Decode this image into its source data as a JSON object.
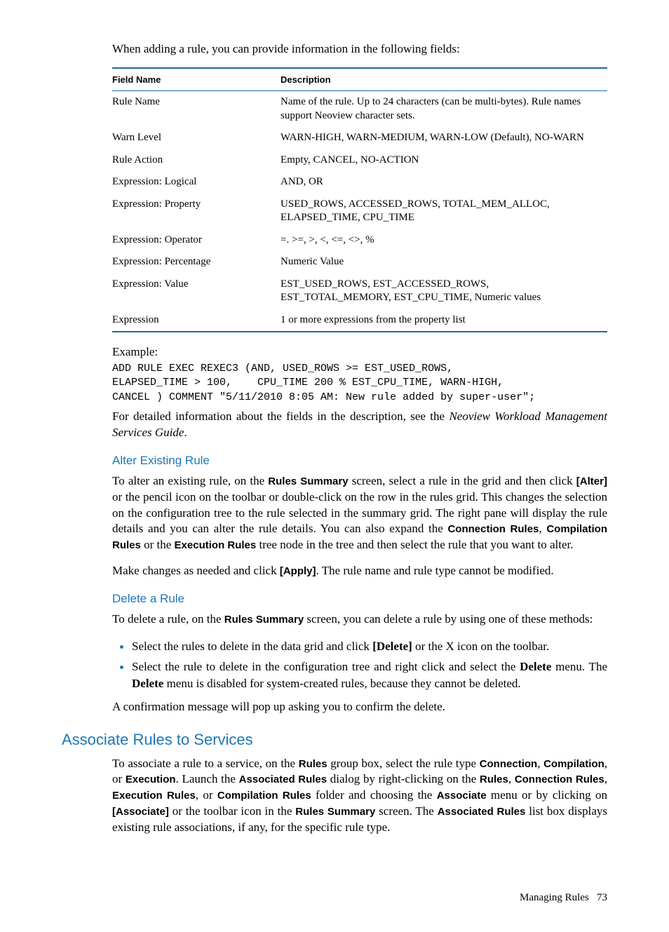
{
  "intro": "When adding a rule, you can provide information in the following fields:",
  "table": {
    "headers": {
      "field": "Field Name",
      "desc": "Description"
    },
    "rows": [
      {
        "field": "Rule Name",
        "desc": "Name of the rule. Up to 24 characters (can be multi-bytes). Rule names support Neoview character sets."
      },
      {
        "field": "Warn Level",
        "desc": "WARN-HIGH, WARN-MEDIUM, WARN-LOW (Default), NO-WARN"
      },
      {
        "field": "Rule Action",
        "desc": "Empty, CANCEL, NO-ACTION"
      },
      {
        "field": "Expression: Logical",
        "desc": "AND, OR"
      },
      {
        "field": "Expression: Property",
        "desc": "USED_ROWS, ACCESSED_ROWS, TOTAL_MEM_ALLOC, ELAPSED_TIME, CPU_TIME"
      },
      {
        "field": "Expression: Operator",
        "desc": "=. >=, >, <, <=, <>, %"
      },
      {
        "field": "Expression: Percentage",
        "desc": "Numeric Value"
      },
      {
        "field": "Expression: Value",
        "desc": "EST_USED_ROWS, EST_ACCESSED_ROWS, EST_TOTAL_MEMORY, EST_CPU_TIME, Numeric values"
      },
      {
        "field": "Expression",
        "desc": "1 or more expressions from the property list"
      }
    ]
  },
  "example_label": "Example:",
  "code": "ADD RULE EXEC REXEC3 (AND, USED_ROWS >= EST_USED_ROWS,\nELAPSED_TIME > 100,    CPU_TIME 200 % EST_CPU_TIME, WARN-HIGH,\nCANCEL ) COMMENT \"5/11/2010 8:05 AM: New rule added by super-user\";",
  "detail_a": "For detailed information about the fields in the description, see the ",
  "detail_b_italic": "Neoview Workload Management Services Guide",
  "detail_c": ".",
  "alter": {
    "heading": "Alter Existing Rule",
    "p1_parts": [
      "To alter an existing rule, on the ",
      "Rules Summary",
      " screen, select a rule in the grid and then click ",
      "[Alter]",
      " or the pencil icon on the toolbar or double-click on the row in the rules grid. This changes the selection on the configuration tree to the rule selected in the summary grid. The right pane will display the rule details and you can alter the rule details. You can also expand the ",
      "Connection Rules",
      ", ",
      "Compilation Rules",
      " or the ",
      "Execution Rules",
      " tree node in the tree and then select the rule that you want to alter."
    ],
    "p2_parts": [
      "Make changes as needed and click ",
      "[Apply]",
      ". The rule name and rule type cannot be modified."
    ]
  },
  "delete": {
    "heading": "Delete a Rule",
    "p1_parts": [
      "To delete a rule, on the ",
      "Rules Summary",
      " screen, you can delete a rule by using one of these methods:"
    ],
    "bullets": [
      [
        "Select the rules to delete in the data grid and click ",
        "[Delete]",
        " or the X icon on the toolbar."
      ],
      [
        "Select the rule to delete in the configuration tree and right click and select the ",
        "Delete",
        " menu. The ",
        "Delete",
        " menu is disabled for system-created rules, because they cannot be deleted."
      ]
    ],
    "p2": "A confirmation message will pop up asking you to confirm the delete."
  },
  "associate": {
    "heading": "Associate Rules to Services",
    "p_parts": [
      "To associate a rule to a service, on the ",
      "Rules",
      " group box, select the rule type ",
      "Connection",
      ", ",
      "Compilation",
      ", or ",
      "Execution",
      ". Launch the ",
      "Associated Rules",
      " dialog by right-clicking on the ",
      "Rules",
      ", ",
      "Connection Rules",
      ", ",
      "Execution Rules",
      ", or ",
      "Compilation Rules",
      " folder and choosing the ",
      "Associate",
      " menu or by clicking on ",
      "[Associate]",
      " or the toolbar icon in the ",
      "Rules Summary",
      " screen. The ",
      "Associated Rules",
      " list box displays existing rule associations, if any, for the specific rule type."
    ]
  },
  "footer": {
    "label": "Managing Rules",
    "page": "73"
  }
}
